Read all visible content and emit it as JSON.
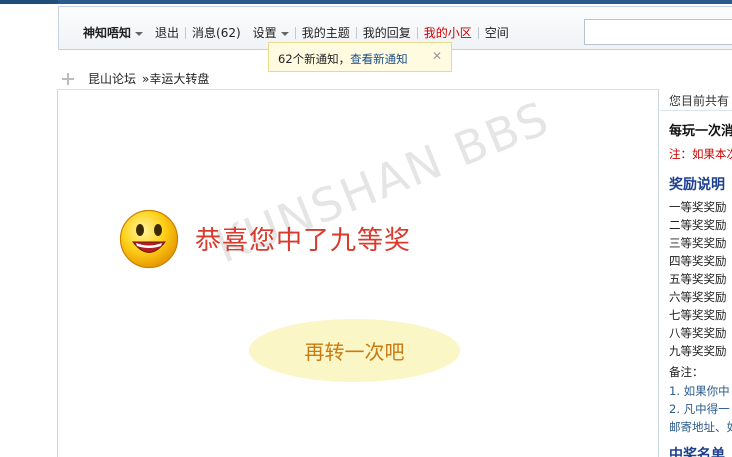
{
  "nav": {
    "username": "神知唔知",
    "logout": "退出",
    "messages": "消息(62)",
    "settings": "设置",
    "my_topics": "我的主题",
    "my_replies": "我的回复",
    "my_community": "我的小区",
    "space": "空间"
  },
  "notice": {
    "text": "62个新通知，",
    "link": "查看新通知",
    "close": "✕"
  },
  "breadcrumb": {
    "forum": "昆山论坛",
    "sep": "»",
    "page": "幸运大转盘"
  },
  "result": {
    "message": "恭喜您中了九等奖",
    "again_button": "再转一次吧",
    "watermark": "KUNSHAN BBS"
  },
  "sidebar": {
    "online": "您目前共有",
    "heading1": "每玩一次消",
    "note": "注：如果本次",
    "heading2": "奖励说明",
    "prizes": [
      "一等奖奖励",
      "二等奖奖励",
      "三等奖奖励",
      "四等奖奖励",
      "五等奖奖励",
      "六等奖奖励",
      "七等奖奖励",
      "八等奖奖励",
      "九等奖奖励"
    ],
    "remarks_label": "备注：",
    "remark1": "1. 如果你中",
    "remark2": "2. 凡中得一",
    "remark3": "邮寄地址、如",
    "heading3": "中奖名单"
  }
}
